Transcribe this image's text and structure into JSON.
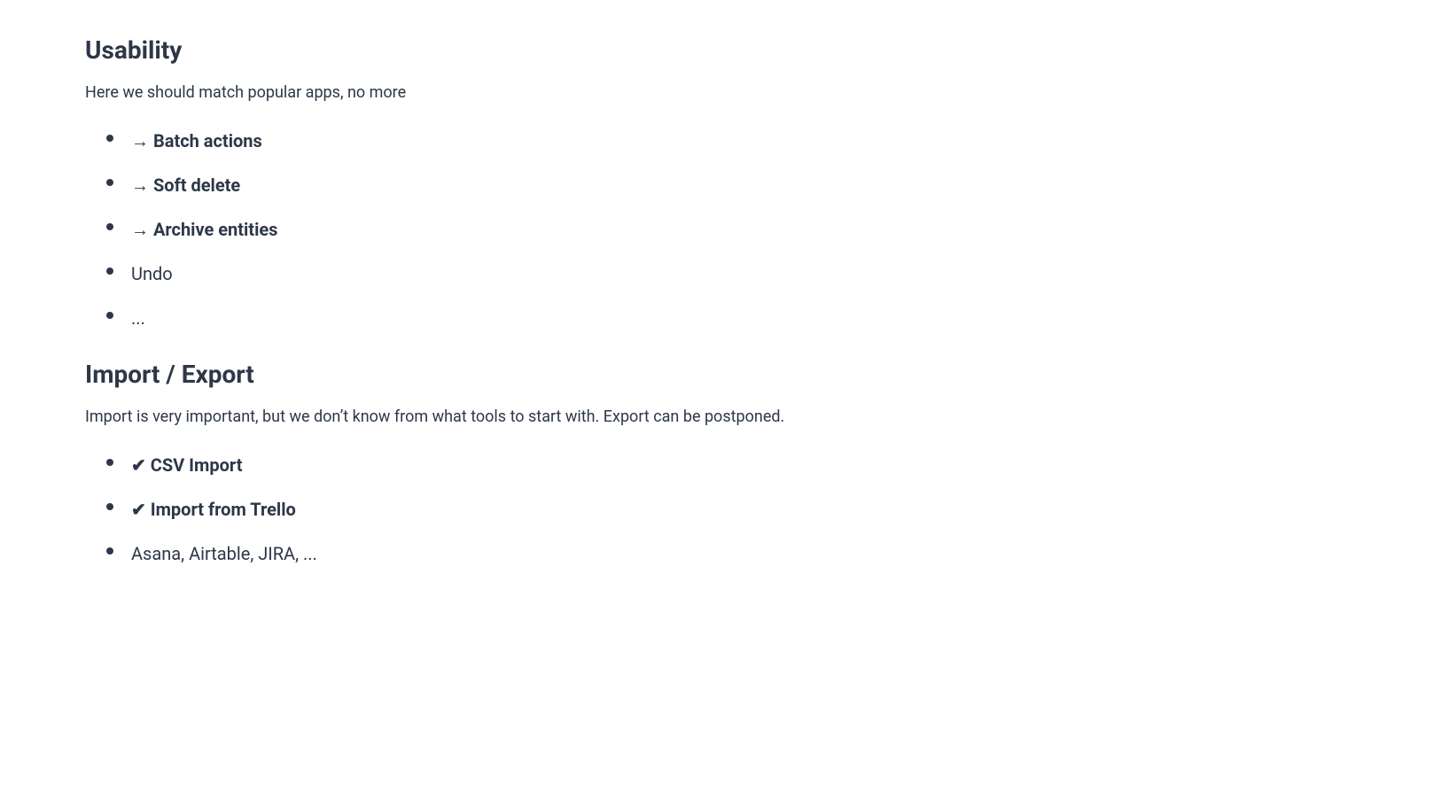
{
  "usability": {
    "title": "Usability",
    "description": "Here we should match popular apps, no more",
    "items": [
      {
        "id": "batch-actions",
        "text": "→ Batch actions",
        "style": "bold-arrow"
      },
      {
        "id": "soft-delete",
        "text": "→ Soft delete",
        "style": "bold-arrow"
      },
      {
        "id": "archive-entities",
        "text": "→ Archive entities",
        "style": "bold-arrow"
      },
      {
        "id": "undo",
        "text": "Undo",
        "style": "plain"
      },
      {
        "id": "ellipsis",
        "text": "...",
        "style": "plain"
      }
    ]
  },
  "import_export": {
    "title": "Import / Export",
    "description": "Import is very important, but we don’t know from what tools to start with. Export can be postponed.",
    "items": [
      {
        "id": "csv-import",
        "text": "✔ CSV Import",
        "style": "checkmark"
      },
      {
        "id": "import-trello",
        "text": "✔ Import from Trello",
        "style": "checkmark"
      },
      {
        "id": "asana-airtable",
        "text": "Asana, Airtable, JIRA, ...",
        "style": "plain"
      }
    ]
  }
}
